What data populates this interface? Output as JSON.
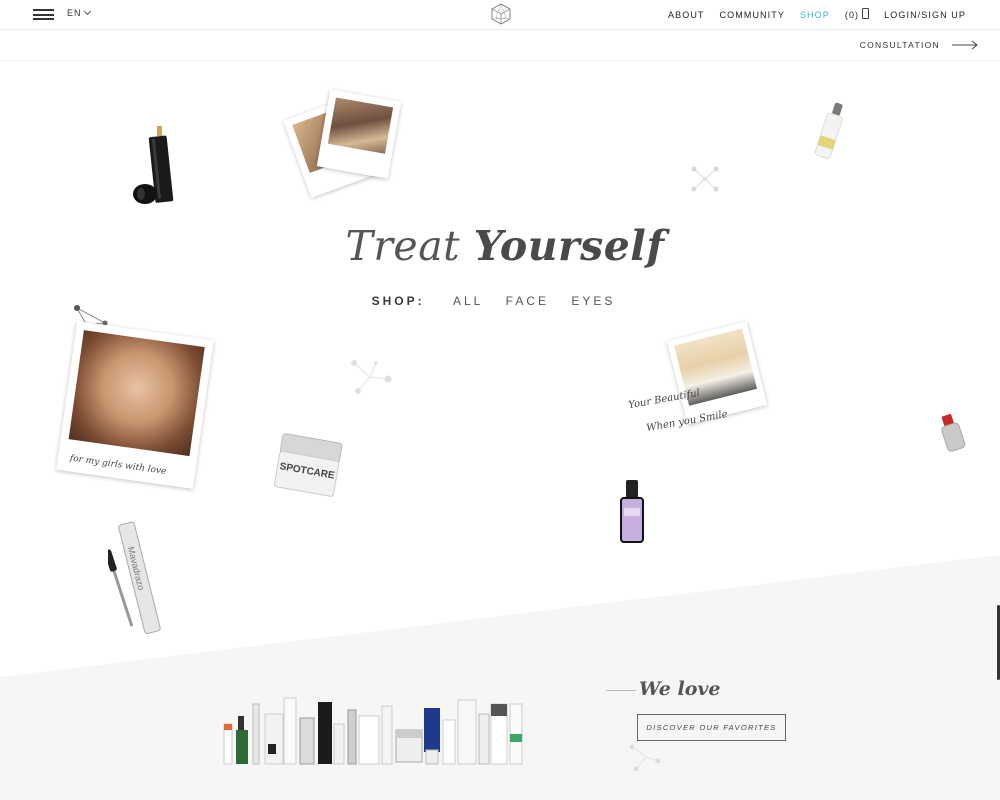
{
  "header": {
    "lang": "EN",
    "nav": [
      {
        "label": "ABOUT",
        "active": false
      },
      {
        "label": "COMMUNITY",
        "active": false
      },
      {
        "label": "SHOP",
        "active": true
      }
    ],
    "cart_count": "(0)",
    "login": "LOGIN/SIGN UP",
    "active_color": "#35b5c9"
  },
  "subheader": {
    "consultation": "CONSULTATION"
  },
  "hero": {
    "title_light": "Treat ",
    "title_bold": "Yourself",
    "shop_label": "SHOP:",
    "filters": [
      "ALL",
      "FACE",
      "EYES"
    ]
  },
  "captions": {
    "portrait": "for my girls with love",
    "sunglasses_1": "Your Beautiful",
    "sunglasses_2": "When you Smile"
  },
  "products": {
    "jar_label": "SPOTCARE",
    "mascara_label": "Mavadrazo"
  },
  "favorites": {
    "heading": "We love",
    "button": "DISCOVER OUR FAVORITES"
  },
  "icons": {
    "menu": "hamburger-menu-icon",
    "logo": "geometric-logo-icon",
    "cart": "shopping-bag-icon",
    "arrow": "arrow-right-icon"
  }
}
